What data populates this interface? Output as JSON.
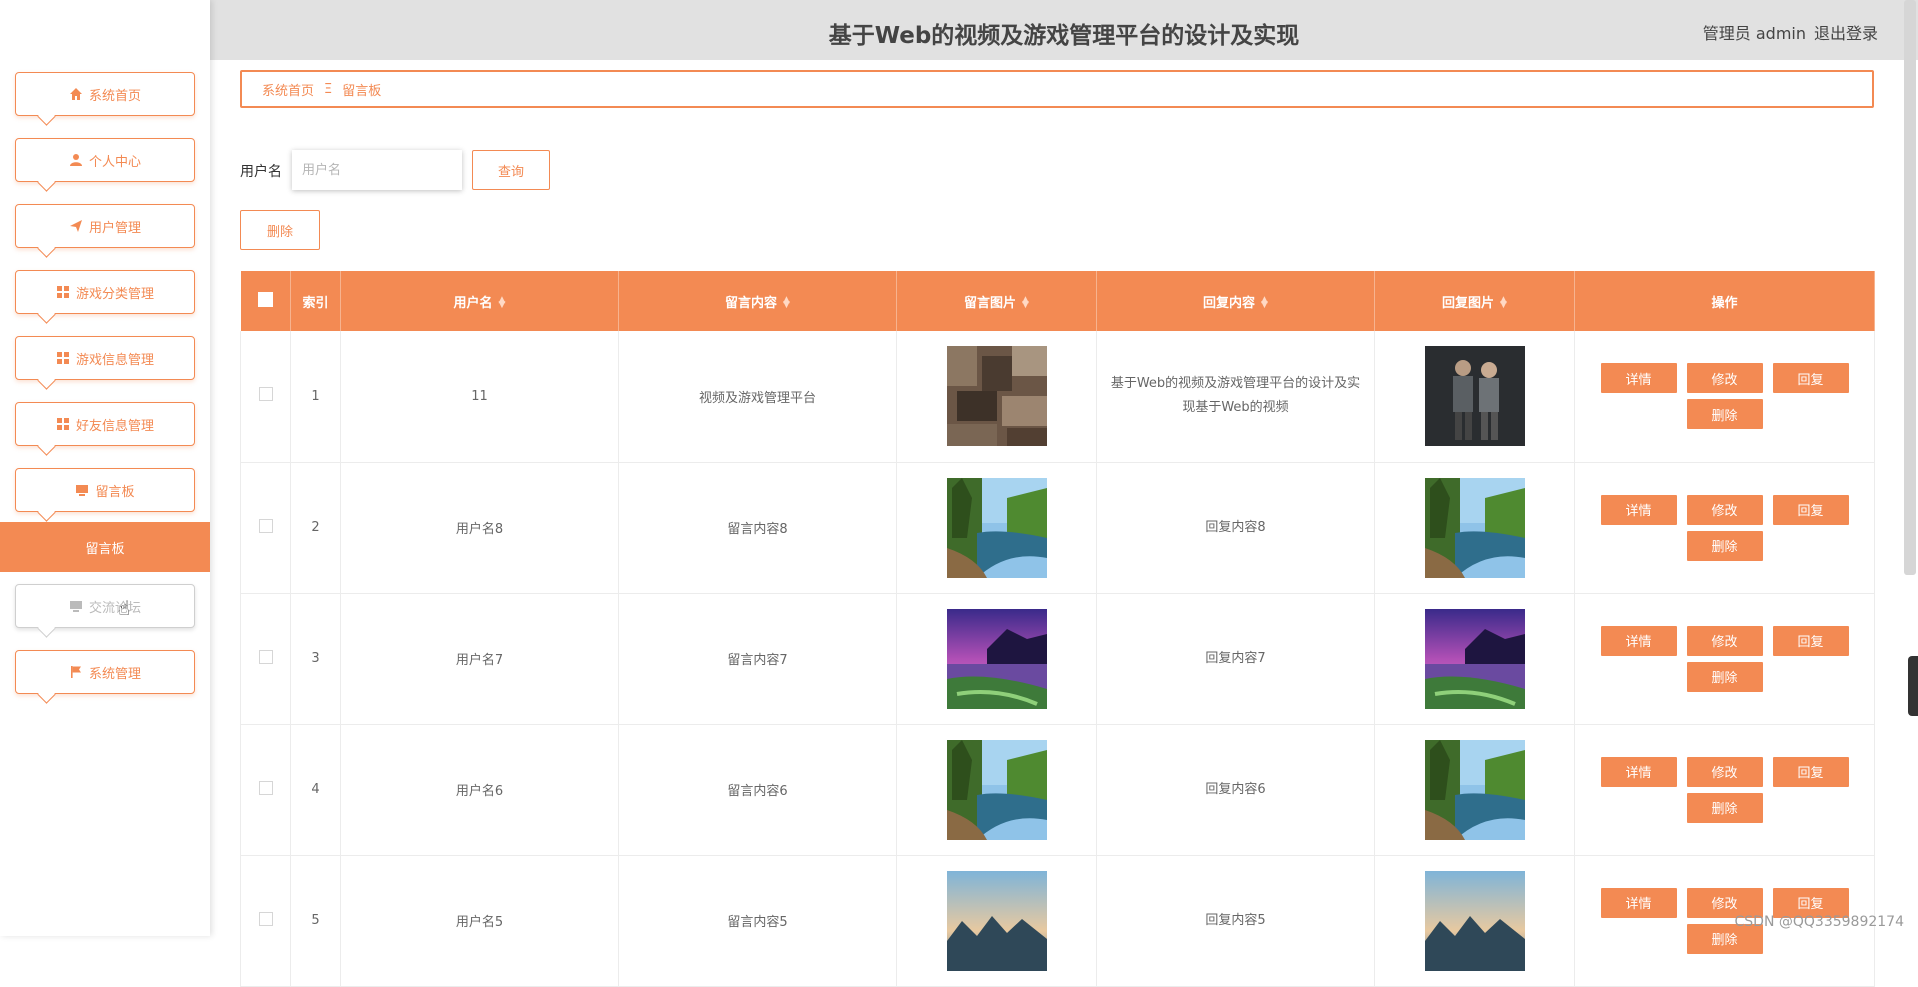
{
  "header": {
    "title": "基于Web的视频及游戏管理平台的设计及实现",
    "user": "管理员 admin",
    "logout": "退出登录"
  },
  "sidebar": {
    "items": [
      {
        "label": "系统首页",
        "icon": "home-icon"
      },
      {
        "label": "个人中心",
        "icon": "user-icon"
      },
      {
        "label": "用户管理",
        "icon": "paper-plane-icon"
      },
      {
        "label": "游戏分类管理",
        "icon": "grid-icon"
      },
      {
        "label": "游戏信息管理",
        "icon": "grid-icon"
      },
      {
        "label": "好友信息管理",
        "icon": "grid-icon"
      },
      {
        "label": "留言板",
        "icon": "monitor-icon"
      },
      {
        "label": "交流论坛",
        "icon": "monitor-icon"
      },
      {
        "label": "系统管理",
        "icon": "flag-icon"
      }
    ],
    "active_sub": "留言板",
    "accent": "#f38a53"
  },
  "breadcrumb": {
    "home": "系统首页",
    "separator": "Ξ",
    "current": "留言板"
  },
  "search": {
    "label": "用户名",
    "placeholder": "用户名",
    "query_button": "查询",
    "delete_button": "删除"
  },
  "table": {
    "headers": [
      "索引",
      "用户名",
      "留言内容",
      "留言图片",
      "回复内容",
      "回复图片",
      "操作"
    ],
    "rows": [
      {
        "index": "1",
        "username": "11",
        "content": "视频及游戏管理平台",
        "reply": "基于Web的视频及游戏管理平台的设计及实现基于Web的视频",
        "img": "mosaic",
        "reply_img": "characters"
      },
      {
        "index": "2",
        "username": "用户名8",
        "content": "留言内容8",
        "reply": "回复内容8",
        "img": "river",
        "reply_img": "river"
      },
      {
        "index": "3",
        "username": "用户名7",
        "content": "留言内容7",
        "reply": "回复内容7",
        "img": "sunset",
        "reply_img": "sunset"
      },
      {
        "index": "4",
        "username": "用户名6",
        "content": "留言内容6",
        "reply": "回复内容6",
        "img": "river",
        "reply_img": "river"
      },
      {
        "index": "5",
        "username": "用户名5",
        "content": "留言内容5",
        "reply": "回复内容5",
        "img": "mountain",
        "reply_img": "mountain"
      }
    ],
    "actions": {
      "detail": "详情",
      "edit": "修改",
      "reply": "回复",
      "delete": "删除"
    }
  },
  "watermark": "CSDN @QQ3359892174"
}
